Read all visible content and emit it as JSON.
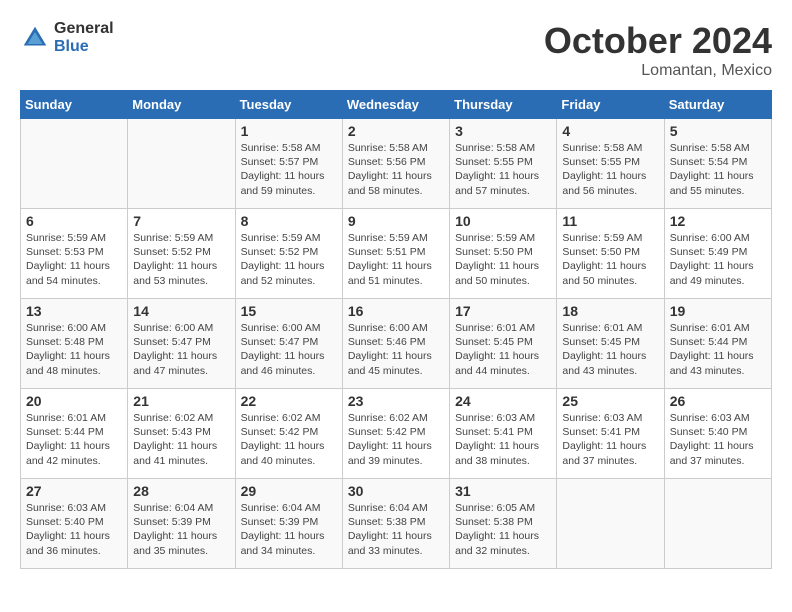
{
  "header": {
    "logo_general": "General",
    "logo_blue": "Blue",
    "month": "October 2024",
    "location": "Lomantan, Mexico"
  },
  "days_of_week": [
    "Sunday",
    "Monday",
    "Tuesday",
    "Wednesday",
    "Thursday",
    "Friday",
    "Saturday"
  ],
  "weeks": [
    [
      {
        "day": "",
        "sunrise": "",
        "sunset": "",
        "daylight": ""
      },
      {
        "day": "",
        "sunrise": "",
        "sunset": "",
        "daylight": ""
      },
      {
        "day": "1",
        "sunrise": "Sunrise: 5:58 AM",
        "sunset": "Sunset: 5:57 PM",
        "daylight": "Daylight: 11 hours and 59 minutes."
      },
      {
        "day": "2",
        "sunrise": "Sunrise: 5:58 AM",
        "sunset": "Sunset: 5:56 PM",
        "daylight": "Daylight: 11 hours and 58 minutes."
      },
      {
        "day": "3",
        "sunrise": "Sunrise: 5:58 AM",
        "sunset": "Sunset: 5:55 PM",
        "daylight": "Daylight: 11 hours and 57 minutes."
      },
      {
        "day": "4",
        "sunrise": "Sunrise: 5:58 AM",
        "sunset": "Sunset: 5:55 PM",
        "daylight": "Daylight: 11 hours and 56 minutes."
      },
      {
        "day": "5",
        "sunrise": "Sunrise: 5:58 AM",
        "sunset": "Sunset: 5:54 PM",
        "daylight": "Daylight: 11 hours and 55 minutes."
      }
    ],
    [
      {
        "day": "6",
        "sunrise": "Sunrise: 5:59 AM",
        "sunset": "Sunset: 5:53 PM",
        "daylight": "Daylight: 11 hours and 54 minutes."
      },
      {
        "day": "7",
        "sunrise": "Sunrise: 5:59 AM",
        "sunset": "Sunset: 5:52 PM",
        "daylight": "Daylight: 11 hours and 53 minutes."
      },
      {
        "day": "8",
        "sunrise": "Sunrise: 5:59 AM",
        "sunset": "Sunset: 5:52 PM",
        "daylight": "Daylight: 11 hours and 52 minutes."
      },
      {
        "day": "9",
        "sunrise": "Sunrise: 5:59 AM",
        "sunset": "Sunset: 5:51 PM",
        "daylight": "Daylight: 11 hours and 51 minutes."
      },
      {
        "day": "10",
        "sunrise": "Sunrise: 5:59 AM",
        "sunset": "Sunset: 5:50 PM",
        "daylight": "Daylight: 11 hours and 50 minutes."
      },
      {
        "day": "11",
        "sunrise": "Sunrise: 5:59 AM",
        "sunset": "Sunset: 5:50 PM",
        "daylight": "Daylight: 11 hours and 50 minutes."
      },
      {
        "day": "12",
        "sunrise": "Sunrise: 6:00 AM",
        "sunset": "Sunset: 5:49 PM",
        "daylight": "Daylight: 11 hours and 49 minutes."
      }
    ],
    [
      {
        "day": "13",
        "sunrise": "Sunrise: 6:00 AM",
        "sunset": "Sunset: 5:48 PM",
        "daylight": "Daylight: 11 hours and 48 minutes."
      },
      {
        "day": "14",
        "sunrise": "Sunrise: 6:00 AM",
        "sunset": "Sunset: 5:47 PM",
        "daylight": "Daylight: 11 hours and 47 minutes."
      },
      {
        "day": "15",
        "sunrise": "Sunrise: 6:00 AM",
        "sunset": "Sunset: 5:47 PM",
        "daylight": "Daylight: 11 hours and 46 minutes."
      },
      {
        "day": "16",
        "sunrise": "Sunrise: 6:00 AM",
        "sunset": "Sunset: 5:46 PM",
        "daylight": "Daylight: 11 hours and 45 minutes."
      },
      {
        "day": "17",
        "sunrise": "Sunrise: 6:01 AM",
        "sunset": "Sunset: 5:45 PM",
        "daylight": "Daylight: 11 hours and 44 minutes."
      },
      {
        "day": "18",
        "sunrise": "Sunrise: 6:01 AM",
        "sunset": "Sunset: 5:45 PM",
        "daylight": "Daylight: 11 hours and 43 minutes."
      },
      {
        "day": "19",
        "sunrise": "Sunrise: 6:01 AM",
        "sunset": "Sunset: 5:44 PM",
        "daylight": "Daylight: 11 hours and 43 minutes."
      }
    ],
    [
      {
        "day": "20",
        "sunrise": "Sunrise: 6:01 AM",
        "sunset": "Sunset: 5:44 PM",
        "daylight": "Daylight: 11 hours and 42 minutes."
      },
      {
        "day": "21",
        "sunrise": "Sunrise: 6:02 AM",
        "sunset": "Sunset: 5:43 PM",
        "daylight": "Daylight: 11 hours and 41 minutes."
      },
      {
        "day": "22",
        "sunrise": "Sunrise: 6:02 AM",
        "sunset": "Sunset: 5:42 PM",
        "daylight": "Daylight: 11 hours and 40 minutes."
      },
      {
        "day": "23",
        "sunrise": "Sunrise: 6:02 AM",
        "sunset": "Sunset: 5:42 PM",
        "daylight": "Daylight: 11 hours and 39 minutes."
      },
      {
        "day": "24",
        "sunrise": "Sunrise: 6:03 AM",
        "sunset": "Sunset: 5:41 PM",
        "daylight": "Daylight: 11 hours and 38 minutes."
      },
      {
        "day": "25",
        "sunrise": "Sunrise: 6:03 AM",
        "sunset": "Sunset: 5:41 PM",
        "daylight": "Daylight: 11 hours and 37 minutes."
      },
      {
        "day": "26",
        "sunrise": "Sunrise: 6:03 AM",
        "sunset": "Sunset: 5:40 PM",
        "daylight": "Daylight: 11 hours and 37 minutes."
      }
    ],
    [
      {
        "day": "27",
        "sunrise": "Sunrise: 6:03 AM",
        "sunset": "Sunset: 5:40 PM",
        "daylight": "Daylight: 11 hours and 36 minutes."
      },
      {
        "day": "28",
        "sunrise": "Sunrise: 6:04 AM",
        "sunset": "Sunset: 5:39 PM",
        "daylight": "Daylight: 11 hours and 35 minutes."
      },
      {
        "day": "29",
        "sunrise": "Sunrise: 6:04 AM",
        "sunset": "Sunset: 5:39 PM",
        "daylight": "Daylight: 11 hours and 34 minutes."
      },
      {
        "day": "30",
        "sunrise": "Sunrise: 6:04 AM",
        "sunset": "Sunset: 5:38 PM",
        "daylight": "Daylight: 11 hours and 33 minutes."
      },
      {
        "day": "31",
        "sunrise": "Sunrise: 6:05 AM",
        "sunset": "Sunset: 5:38 PM",
        "daylight": "Daylight: 11 hours and 32 minutes."
      },
      {
        "day": "",
        "sunrise": "",
        "sunset": "",
        "daylight": ""
      },
      {
        "day": "",
        "sunrise": "",
        "sunset": "",
        "daylight": ""
      }
    ]
  ]
}
